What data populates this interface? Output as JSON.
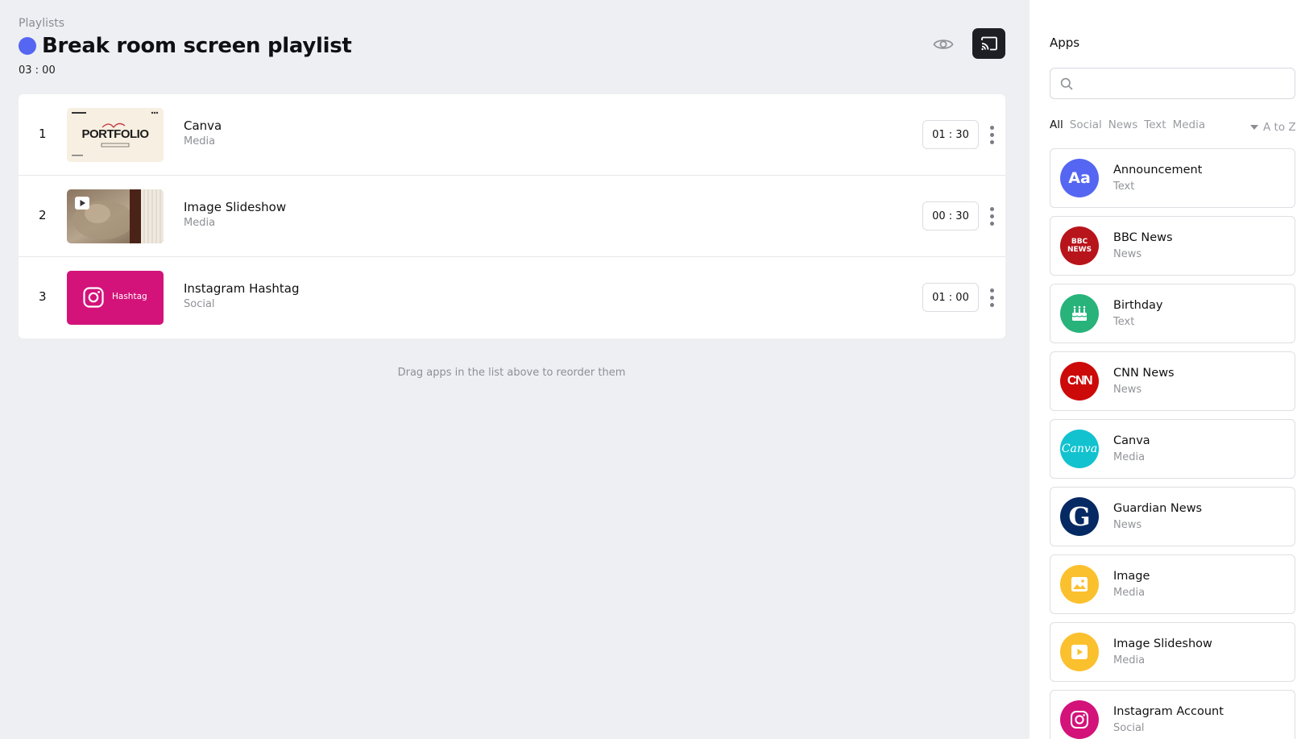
{
  "header": {
    "breadcrumb": "Playlists",
    "title": "Break room screen playlist",
    "total_duration": "03 : 00",
    "title_dot_color": "#5566f2"
  },
  "playlist": [
    {
      "index": "1",
      "name": "Canva",
      "type": "Media",
      "duration": "01 : 30",
      "thumb": "canva-portfolio",
      "thumb_text": "PORTFOLIO"
    },
    {
      "index": "2",
      "name": "Image Slideshow",
      "type": "Media",
      "duration": "00 : 30",
      "thumb": "image-slideshow"
    },
    {
      "index": "3",
      "name": "Instagram Hashtag",
      "type": "Social",
      "duration": "01 : 00",
      "thumb": "instagram-hashtag",
      "thumb_text": "Hashtag"
    }
  ],
  "hint": "Drag apps in the list above to reorder them",
  "sidebar": {
    "title": "Apps",
    "search_placeholder": "",
    "filters": [
      "All",
      "Social",
      "News",
      "Text",
      "Media"
    ],
    "active_filter": "All",
    "sort_label": "A to Z",
    "apps": [
      {
        "name": "Announcement",
        "type": "Text",
        "icon": "announcement-icon",
        "color": "#5566f2",
        "glyph": "Aa"
      },
      {
        "name": "BBC News",
        "type": "News",
        "icon": "bbc-news-icon",
        "color": "#b8141b",
        "glyph": "BBC NEWS"
      },
      {
        "name": "Birthday",
        "type": "Text",
        "icon": "birthday-cake-icon",
        "color": "#27b37a",
        "glyph": ""
      },
      {
        "name": "CNN News",
        "type": "News",
        "icon": "cnn-news-icon",
        "color": "#cc0a0a",
        "glyph": "CNN"
      },
      {
        "name": "Canva",
        "type": "Media",
        "icon": "canva-icon",
        "color": "#12c2cf",
        "glyph": "Canva"
      },
      {
        "name": "Guardian News",
        "type": "News",
        "icon": "guardian-news-icon",
        "color": "#052962",
        "glyph": "G"
      },
      {
        "name": "Image",
        "type": "Media",
        "icon": "image-icon",
        "color": "#fbc02d",
        "glyph": ""
      },
      {
        "name": "Image Slideshow",
        "type": "Media",
        "icon": "slideshow-icon",
        "color": "#fbc02d",
        "glyph": ""
      },
      {
        "name": "Instagram Account",
        "type": "Social",
        "icon": "instagram-icon",
        "color": "#d3137a",
        "glyph": ""
      }
    ]
  }
}
